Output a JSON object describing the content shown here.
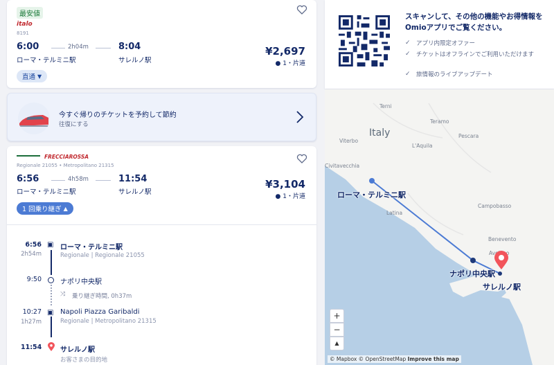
{
  "result1": {
    "badge": "最安値",
    "brand": "italo",
    "train_no": "8191",
    "dep_time": "6:00",
    "arr_time": "8:04",
    "duration": "2h04m",
    "dep_station": "ローマ・テルミニ駅",
    "arr_station": "サレルノ駅",
    "price": "¥2,697",
    "pax": "1・片道",
    "stops_label": "直通"
  },
  "promo": {
    "title": "今すぐ帰りのチケットを予約して節約",
    "subtitle": "往復にする"
  },
  "result2": {
    "brand": "FRECCIAROSSA",
    "train_info": "Regionale 21055 • Metropolitano 21315",
    "dep_time": "6:56",
    "arr_time": "11:54",
    "duration": "4h58m",
    "dep_station": "ローマ・テルミニ駅",
    "arr_station": "サレルノ駅",
    "price": "¥3,104",
    "pax": "1・片道",
    "stops_label": "1 回乗り継ぎ"
  },
  "timeline": [
    {
      "time": "6:56",
      "dur": "2h54m",
      "name": "ローマ・テルミニ駅",
      "sub": "Regionale | Regionale 21055"
    },
    {
      "time": "9:50",
      "name": "ナポリ中央駅"
    },
    {
      "transfer": "乗り継ぎ時間, 0h37m"
    },
    {
      "time": "10:27",
      "dur": "1h27m",
      "name": "Napoli Piazza Garibaldi",
      "sub": "Regionale | Metropolitano 21315"
    },
    {
      "time": "11:54",
      "name": "サレルノ駅",
      "sub": "お客さまの目的地"
    }
  ],
  "qr_panel": {
    "text": "スキャンして、その他の機能やお得情報をOmioアプリでご覧ください。",
    "features": [
      "アプリ内限定オファー",
      "チケットはオフラインでご利用いただけます",
      "旅情報のライブアップデート"
    ]
  },
  "map": {
    "country": "Italy",
    "cities": [
      "Terni",
      "Teramo",
      "Viterbo",
      "L'Aquila",
      "Pescara",
      "Civitavecchia",
      "Latina",
      "Campobasso",
      "Benevento",
      "Avellino"
    ],
    "stations": [
      "ローマ・テルミニ駅",
      "ナポリ中央駅",
      "サレルノ駅"
    ],
    "zoom_in": "+",
    "zoom_out": "−",
    "compass": "▲",
    "attribution": [
      "© Mapbox",
      "© OpenStreetMap",
      "Improve this map"
    ]
  },
  "colors": {
    "brand_navy": "#132968",
    "accent_blue": "#4c7bd4",
    "pin_red": "#f2545b",
    "best_green": "#1d7a3a"
  }
}
